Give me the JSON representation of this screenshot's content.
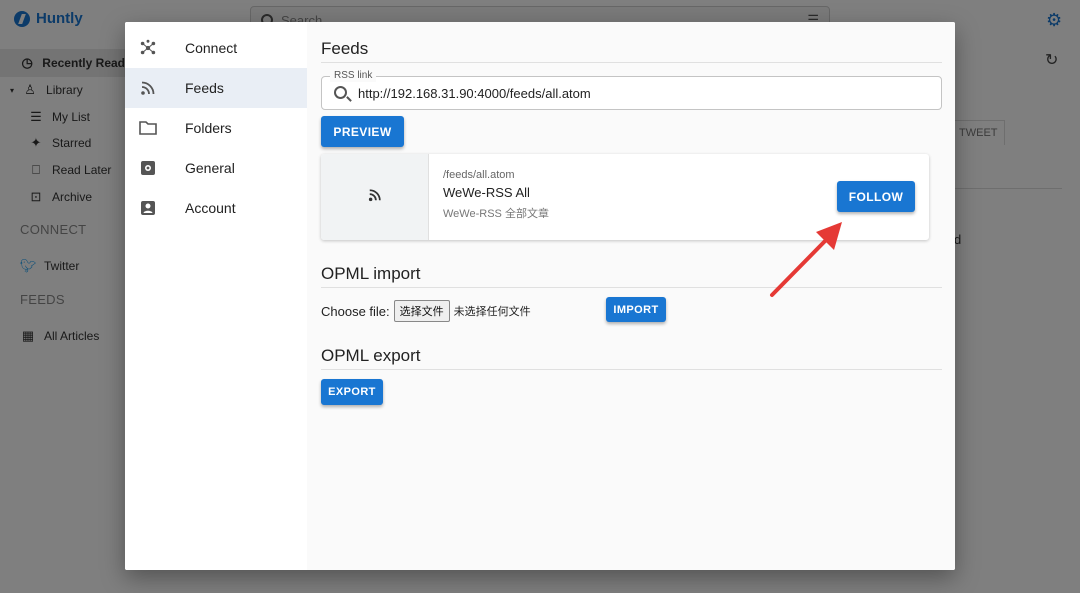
{
  "app": {
    "brand": "Huntly",
    "search_placeholder": "Search",
    "sidebar": {
      "recently_read": "Recently Read",
      "library": "Library",
      "my_list": "My List",
      "starred": "Starred",
      "read_later": "Read Later",
      "archive": "Archive",
      "connect_header": "CONNECT",
      "twitter": "Twitter",
      "feeds_header": "FEEDS",
      "all_articles": "All Articles"
    },
    "tab_tweet": "TWEET",
    "bg_partial_text": "d"
  },
  "dialog": {
    "nav": [
      {
        "label": "Connect",
        "icon": "hub-icon"
      },
      {
        "label": "Feeds",
        "icon": "rss-icon"
      },
      {
        "label": "Folders",
        "icon": "folder-icon"
      },
      {
        "label": "General",
        "icon": "settings-box-icon"
      },
      {
        "label": "Account",
        "icon": "account-box-icon"
      }
    ],
    "feeds": {
      "title": "Feeds",
      "rss_label": "RSS link",
      "rss_value": "http://192.168.31.90:4000/feeds/all.atom",
      "preview_label": "PREVIEW",
      "preview_card": {
        "path": "/feeds/all.atom",
        "name": "WeWe-RSS All",
        "description": "WeWe-RSS 全部文章",
        "follow_label": "FOLLOW"
      }
    },
    "opml_import": {
      "title": "OPML import",
      "choose_label": "Choose file:",
      "file_button": "选择文件",
      "no_file": "未选择任何文件",
      "import_label": "IMPORT"
    },
    "opml_export": {
      "title": "OPML export",
      "export_label": "EXPORT"
    }
  },
  "colors": {
    "primary": "#1976d2",
    "arrow": "#e53935",
    "active_nav": "#e9eef5"
  }
}
